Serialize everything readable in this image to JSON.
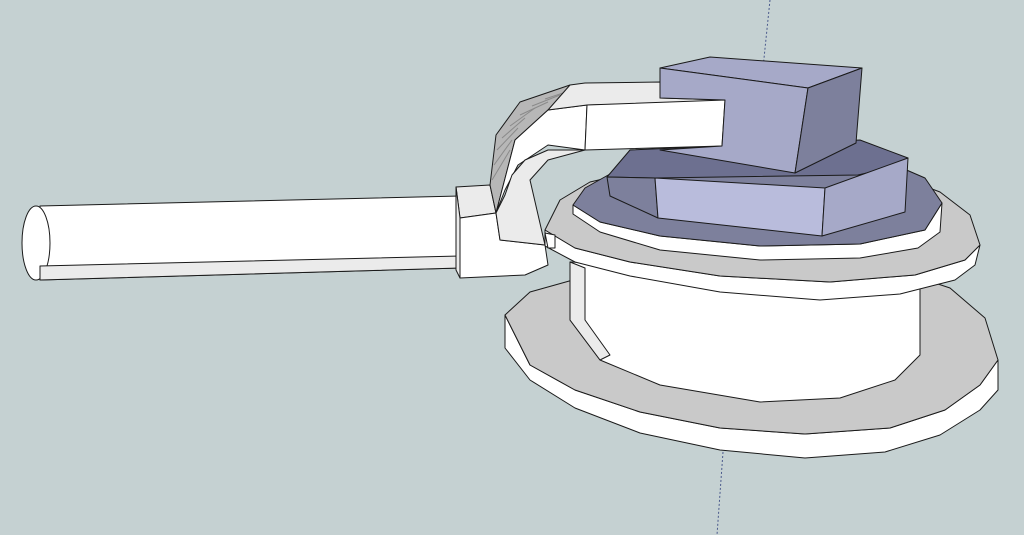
{
  "scene": {
    "background_color": "#c5d1d2",
    "face_white": "#ffffff",
    "face_light_gray": "#ebebeb",
    "face_mid_gray": "#c9c9c9",
    "face_dark_gray": "#b7b7b7",
    "face_lavender": "#a6a9c8",
    "face_lavender_light": "#b9bcdc",
    "face_slate": "#7d809c",
    "face_slate_dark": "#6d7090",
    "edge_color": "#1a1a1a"
  },
  "objects": [
    "blue-axis-line",
    "base-disc",
    "cylinder-body",
    "top-disc",
    "top-plate",
    "lower-block",
    "pipe-rod",
    "bent-arm",
    "upper-block"
  ]
}
